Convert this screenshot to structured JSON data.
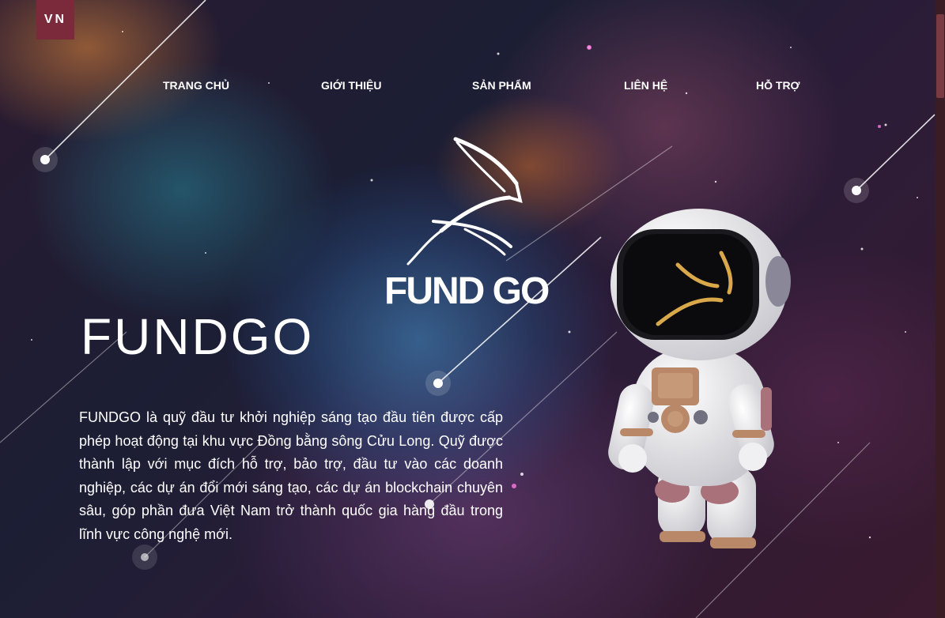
{
  "lang": {
    "label": "VN"
  },
  "nav": {
    "items": [
      {
        "label": "TRANG CHỦ"
      },
      {
        "label": "GIỚI THIỆU"
      },
      {
        "label": "SẢN PHẨM"
      },
      {
        "label": "LIÊN HỆ"
      },
      {
        "label": "HỖ TRỢ"
      }
    ]
  },
  "logo": {
    "text": "FUND GO",
    "icon": "gazelle-logo-icon"
  },
  "hero": {
    "title": "FUNDGO",
    "description": "FUNDGO là quỹ đầu tư khởi nghiệp sáng tạo đầu tiên được cấp phép hoạt động tại khu vực Đồng bằng sông Cửu Long. Quỹ được thành lập với mục đích hỗ trợ, bảo trợ, đầu tư vào các doanh nghiệp, các dự án đổi mới sáng tạo, các dự án blockchain chuyên sâu, góp phần đưa Việt Nam trở thành quốc gia hàng đầu trong lĩnh vực công nghệ mới."
  },
  "colors": {
    "accent": "#7b2a3c",
    "gold": "#d8a84a"
  }
}
